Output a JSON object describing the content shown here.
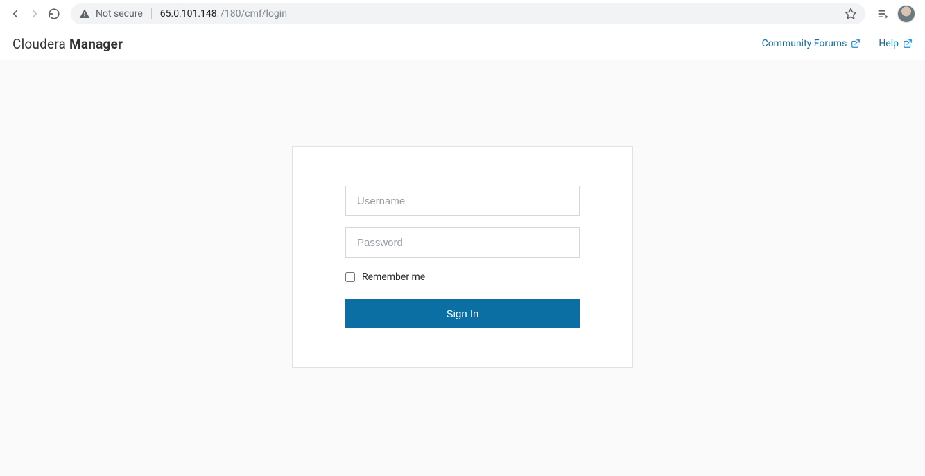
{
  "browser": {
    "not_secure_label": "Not secure",
    "url_host": "65.0.101.148",
    "url_port_path": ":7180/cmf/login"
  },
  "header": {
    "brand_light": "Cloudera ",
    "brand_bold": "Manager",
    "links": {
      "community": "Community Forums",
      "help": "Help"
    }
  },
  "login": {
    "username_placeholder": "Username",
    "password_placeholder": "Password",
    "remember_label": "Remember me",
    "signin_label": "Sign In"
  }
}
